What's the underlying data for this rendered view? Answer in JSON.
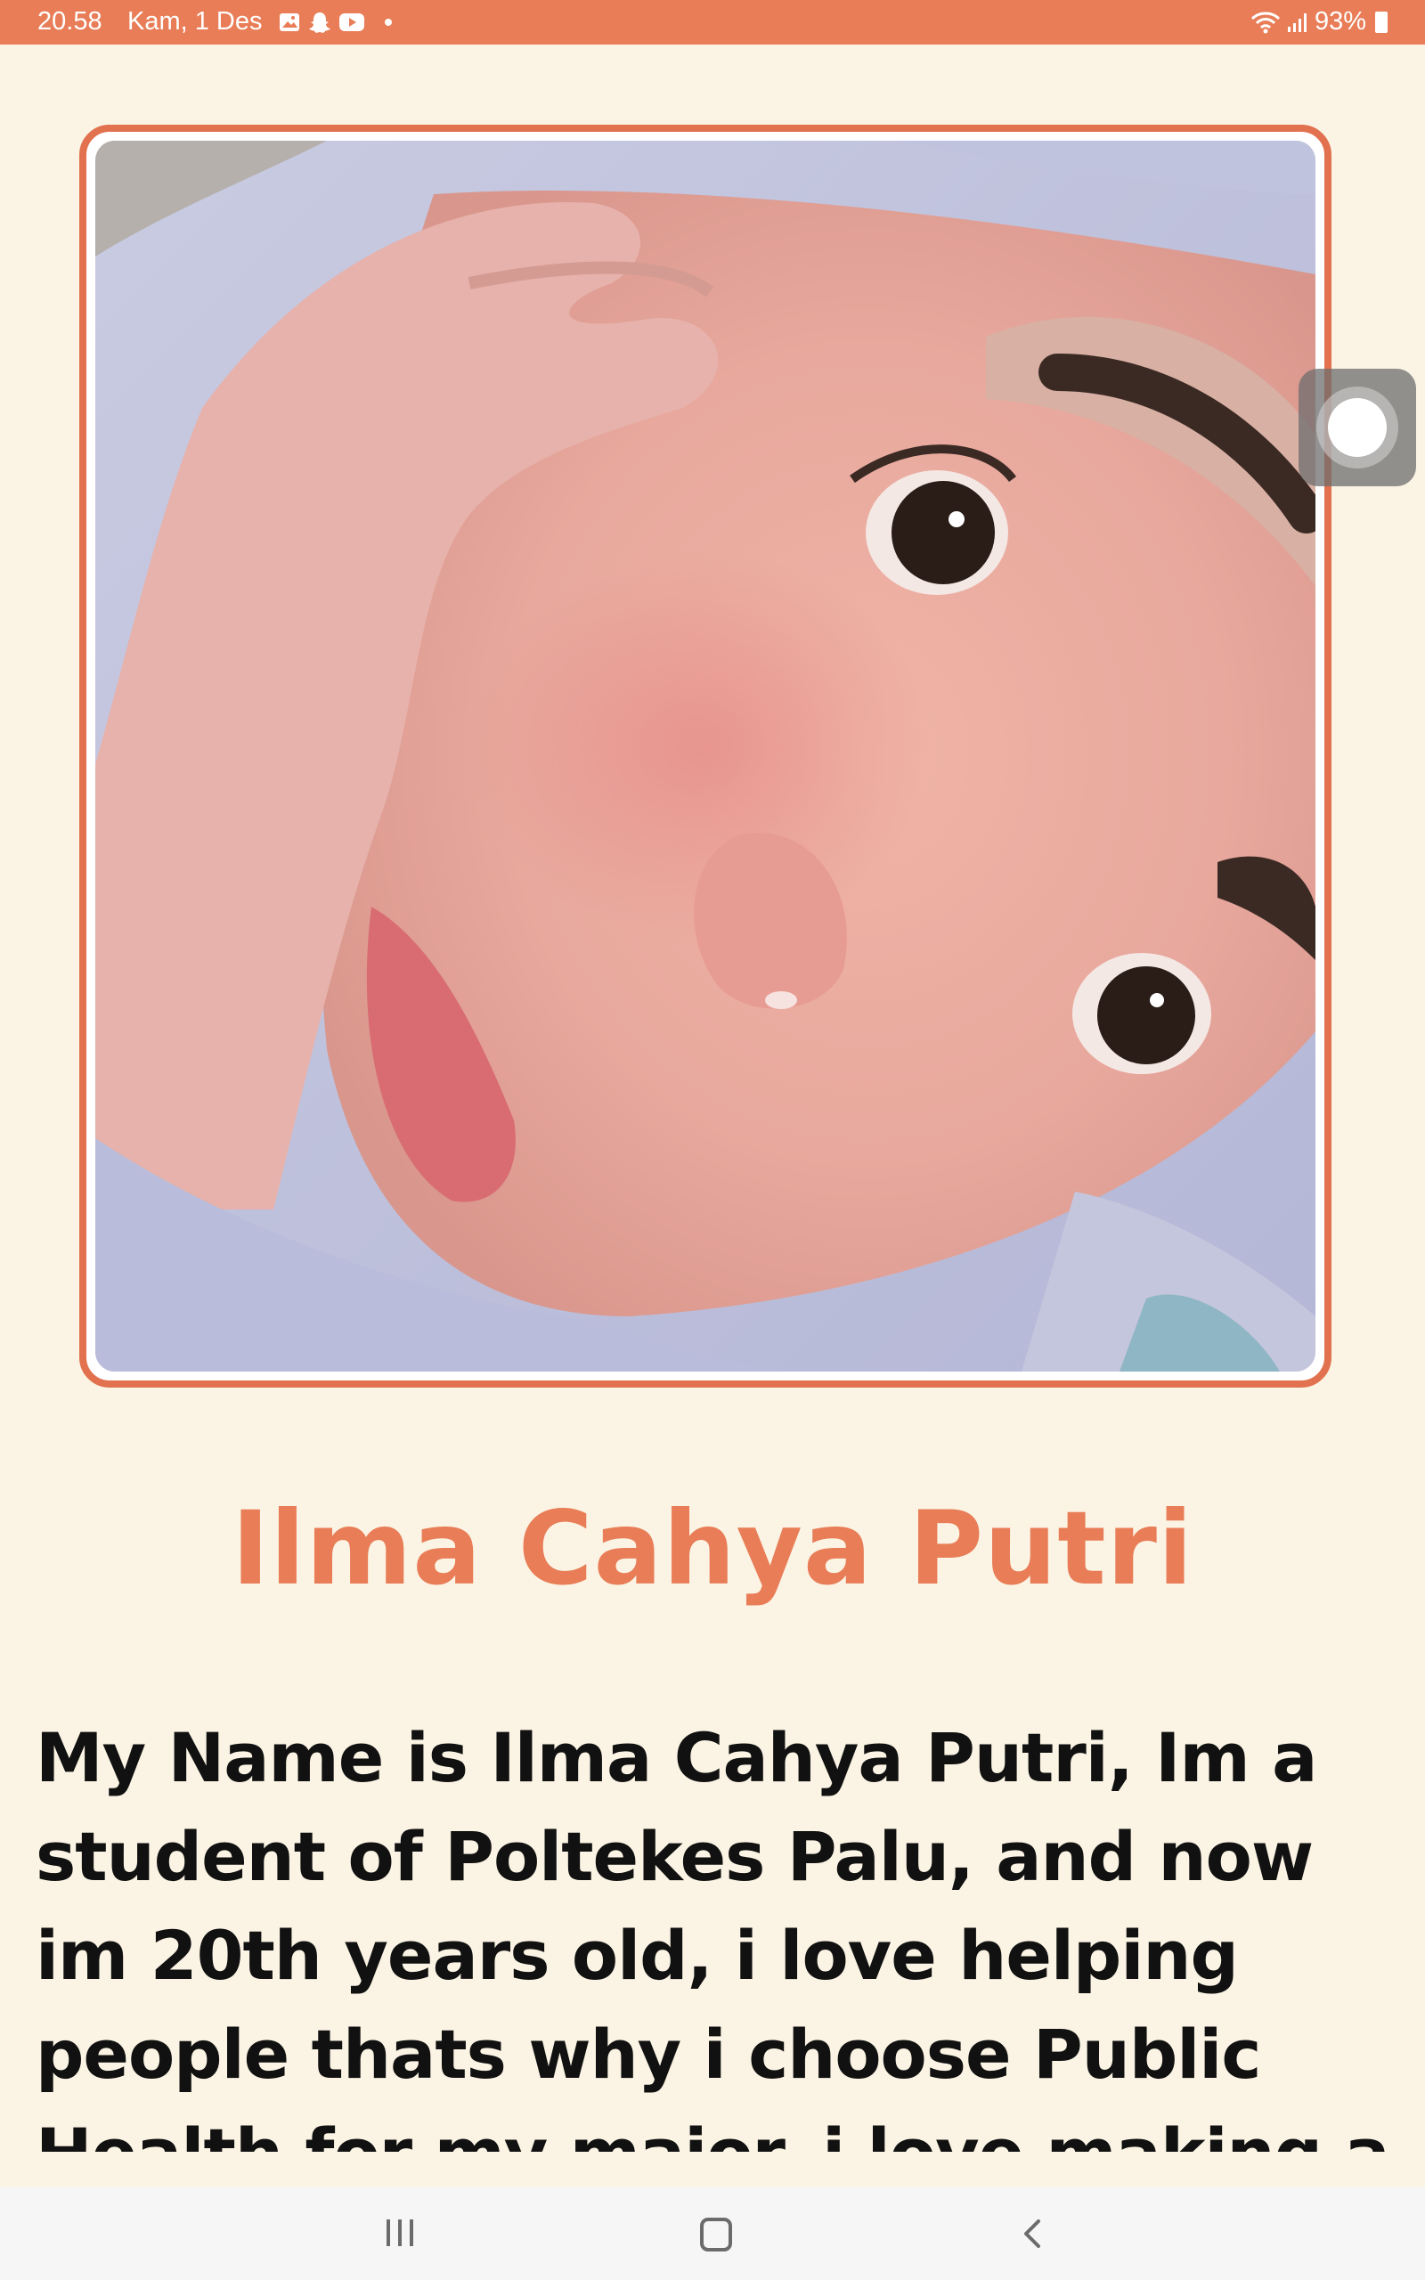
{
  "status_bar": {
    "time": "20.58",
    "date": "Kam, 1 Des",
    "battery": "93%",
    "notification_icons": [
      "gallery-icon",
      "snapchat-icon",
      "youtube-icon"
    ]
  },
  "profile": {
    "name": "Ilma Cahya Putri",
    "bio": "My Name is Ilma Cahya Putri, Im a student of Poltekes Palu, and now im 20th years old, i love helping people thats why i choose Public Health for my major, i love making a food for"
  },
  "colors": {
    "accent": "#e87d57",
    "background": "#fbf4e4",
    "text": "#111111"
  },
  "nav_bar": {
    "buttons": [
      "recents",
      "home",
      "back"
    ]
  }
}
